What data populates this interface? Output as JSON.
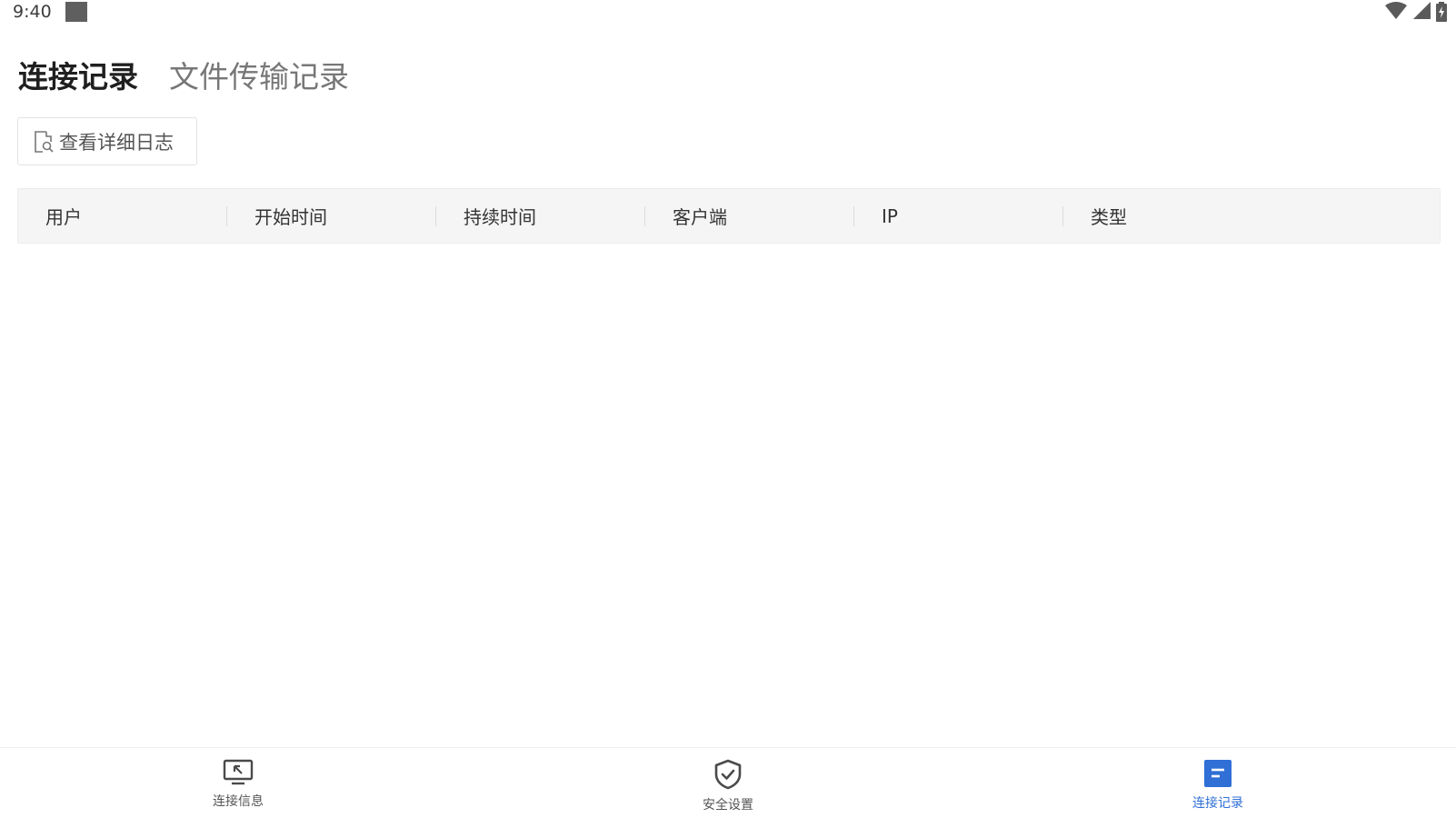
{
  "status_bar": {
    "time": "9:40"
  },
  "tabs": [
    {
      "label": "连接记录",
      "active": true
    },
    {
      "label": "文件传输记录",
      "active": false
    }
  ],
  "log_button": {
    "label": "查看详细日志",
    "icon": "log-search-icon"
  },
  "table": {
    "columns": [
      "用户",
      "开始时间",
      "持续时间",
      "客户端",
      "IP",
      "类型"
    ],
    "rows": []
  },
  "bottom_nav": [
    {
      "label": "连接信息",
      "icon": "monitor-cursor-icon",
      "active": false
    },
    {
      "label": "安全设置",
      "icon": "shield-check-icon",
      "active": false
    },
    {
      "label": "连接记录",
      "icon": "record-doc-icon",
      "active": true
    }
  ],
  "colors": {
    "accent": "#2f6fd6",
    "header_bg": "#f5f5f5",
    "inactive_text": "#777777"
  }
}
